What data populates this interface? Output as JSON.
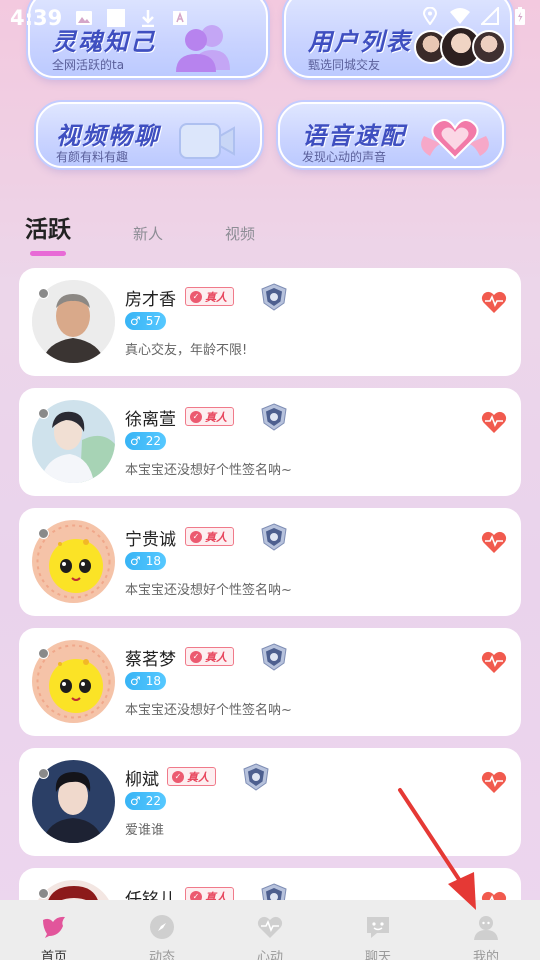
{
  "status_bar": {
    "time": "4:39"
  },
  "features": [
    {
      "title": "灵魂知己",
      "subtitle": "全网活跃的ta"
    },
    {
      "title": "用户列表",
      "subtitle": "甄选同城交友"
    },
    {
      "title": "视频畅聊",
      "subtitle": "有颜有料有趣"
    },
    {
      "title": "语音速配",
      "subtitle": "发现心动的声音"
    }
  ],
  "tabs": [
    "活跃",
    "新人",
    "视频"
  ],
  "real_badge_label": "真人",
  "users": [
    {
      "name": "房才香",
      "age": "57",
      "bio": "真心交友，年龄不限!"
    },
    {
      "name": "徐离萱",
      "age": "22",
      "bio": "本宝宝还没想好个性签名呐~"
    },
    {
      "name": "宁贵诚",
      "age": "18",
      "bio": "本宝宝还没想好个性签名呐~"
    },
    {
      "name": "蔡茗梦",
      "age": "18",
      "bio": "本宝宝还没想好个性签名呐~"
    },
    {
      "name": "柳斌",
      "age": "22",
      "bio": "爱谁谁"
    },
    {
      "name": "任铭儿",
      "age": "",
      "bio": ""
    }
  ],
  "bottom_nav": [
    {
      "label": "首页",
      "icon": "home-bird-icon",
      "active": true
    },
    {
      "label": "动态",
      "icon": "compass-icon",
      "active": false
    },
    {
      "label": "心动",
      "icon": "heart-pulse-icon",
      "active": false
    },
    {
      "label": "聊天",
      "icon": "chat-icon",
      "active": false
    },
    {
      "label": "我的",
      "icon": "profile-icon",
      "active": false
    }
  ],
  "colors": {
    "accent": "#e86ad6",
    "nav_active": "#e2559b",
    "age_badge": "#38b4f5",
    "real_badge": "#e8475e"
  }
}
